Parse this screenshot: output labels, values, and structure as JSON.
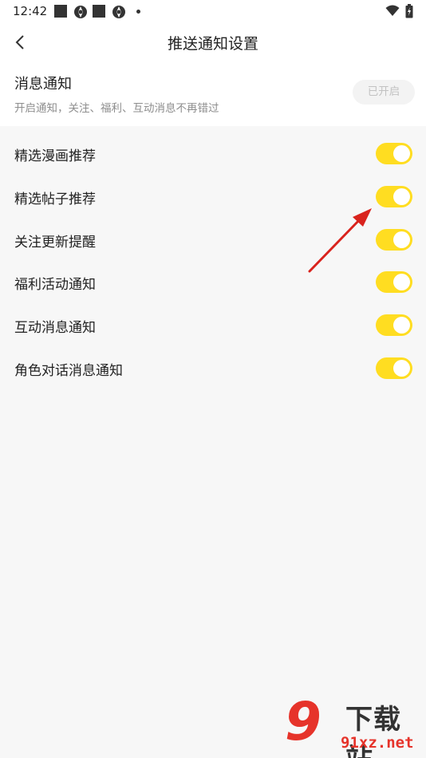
{
  "status_bar": {
    "time": "12:42",
    "icons": [
      "square-notification-icon",
      "gear-notification-icon",
      "square-notification-icon",
      "gear-notification-icon",
      "dot-icon",
      "wifi-icon",
      "battery-icon"
    ]
  },
  "header": {
    "title": "推送通知设置",
    "back_icon": "chevron-left-icon"
  },
  "master": {
    "title": "消息通知",
    "description": "开启通知，关注、福利、互动消息不再错过",
    "status_button": "已开启"
  },
  "settings": [
    {
      "label": "精选漫画推荐",
      "enabled": true
    },
    {
      "label": "精选帖子推荐",
      "enabled": true
    },
    {
      "label": "关注更新提醒",
      "enabled": true
    },
    {
      "label": "福利活动通知",
      "enabled": true
    },
    {
      "label": "互动消息通知",
      "enabled": true
    },
    {
      "label": "角色对话消息通知",
      "enabled": true
    }
  ],
  "colors": {
    "toggle_on": "#ffdd21",
    "annotation_arrow": "#d9231d",
    "watermark_red": "#e6332a"
  },
  "watermark": {
    "logo_text": "9",
    "title": "下载站",
    "url": "91xz.net"
  }
}
